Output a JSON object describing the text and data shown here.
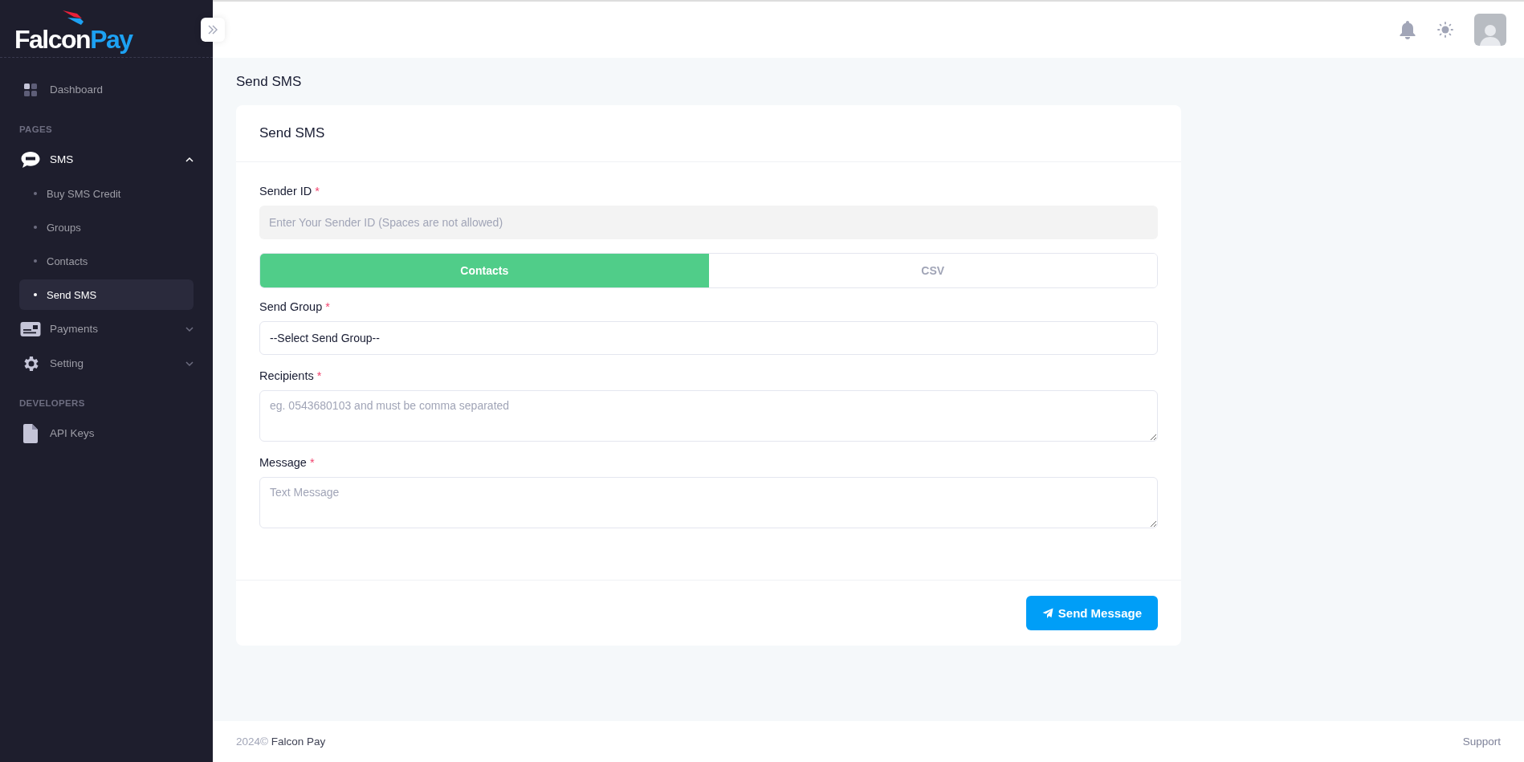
{
  "logo": {
    "primary": "Falcon",
    "accent": "Pay"
  },
  "sidebar": {
    "items": [
      {
        "kind": "link",
        "label": "Dashboard",
        "selected": false
      },
      {
        "kind": "section",
        "label": "PAGES"
      },
      {
        "kind": "group",
        "label": "SMS",
        "expanded": true,
        "children": [
          {
            "label": "Buy SMS Credit",
            "selected": false
          },
          {
            "label": "Groups",
            "selected": false
          },
          {
            "label": "Contacts",
            "selected": false
          },
          {
            "label": "Send SMS",
            "selected": true
          }
        ]
      },
      {
        "kind": "group",
        "label": "Payments",
        "expanded": false
      },
      {
        "kind": "group",
        "label": "Setting",
        "expanded": false
      },
      {
        "kind": "section",
        "label": "DEVELOPERS"
      },
      {
        "kind": "link",
        "label": "API Keys",
        "selected": false
      }
    ]
  },
  "page_title": "Send SMS",
  "card": {
    "title": "Send SMS",
    "sender_id": {
      "label": "Sender ID",
      "required_mark": "*",
      "placeholder": "Enter Your Sender ID (Spaces are not allowed)"
    },
    "tabs": [
      {
        "label": "Contacts",
        "selected": true
      },
      {
        "label": "CSV",
        "selected": false
      }
    ],
    "send_group": {
      "label": "Send Group",
      "required_mark": "*",
      "value": "--Select Send Group--"
    },
    "recipients": {
      "label": "Recipients",
      "required_mark": "*",
      "placeholder": "eg. 0543680103 and must be comma separated"
    },
    "message": {
      "label": "Message",
      "required_mark": "*",
      "placeholder": "Text Message"
    },
    "submit": "Send Message"
  },
  "footer": {
    "year": "2024©",
    "name": "Falcon Pay",
    "link": "Support"
  }
}
